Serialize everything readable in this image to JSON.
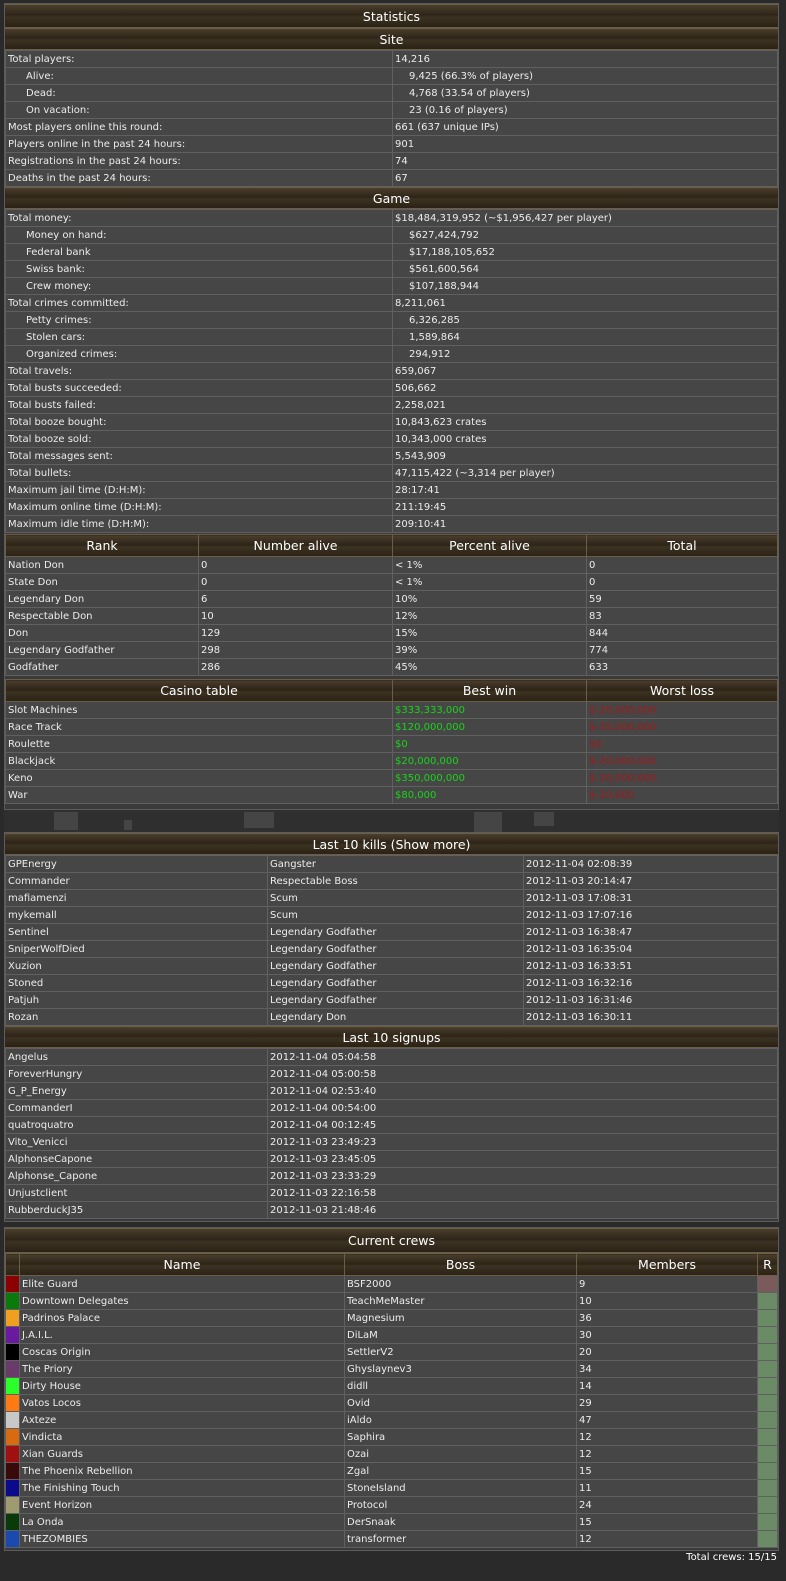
{
  "stats": {
    "title": "Statistics",
    "site_header": "Site",
    "site_rows": [
      {
        "label": "Total players:",
        "value": "14,216",
        "indent": false
      },
      {
        "label": "Alive:",
        "value": "9,425 (66.3% of players)",
        "indent": true
      },
      {
        "label": "Dead:",
        "value": "4,768 (33.54 of players)",
        "indent": true
      },
      {
        "label": "On vacation:",
        "value": "23 (0.16 of players)",
        "indent": true
      },
      {
        "label": "Most players online this round:",
        "value": "661 (637 unique IPs)",
        "indent": false
      },
      {
        "label": "Players online in the past 24 hours:",
        "value": "901",
        "indent": false
      },
      {
        "label": "Registrations in the past 24 hours:",
        "value": "74",
        "indent": false
      },
      {
        "label": "Deaths in the past 24 hours:",
        "value": "67",
        "indent": false
      }
    ],
    "game_header": "Game",
    "game_rows": [
      {
        "label": "Total money:",
        "value": "$18,484,319,952 (~$1,956,427 per player)",
        "indent": false
      },
      {
        "label": "Money on hand:",
        "value": "$627,424,792",
        "indent": true
      },
      {
        "label": "Federal bank",
        "value": "$17,188,105,652",
        "indent": true
      },
      {
        "label": "Swiss bank:",
        "value": "$561,600,564",
        "indent": true
      },
      {
        "label": "Crew money:",
        "value": "$107,188,944",
        "indent": true
      },
      {
        "label": "Total crimes committed:",
        "value": "8,211,061",
        "indent": false
      },
      {
        "label": "Petty crimes:",
        "value": "6,326,285",
        "indent": true
      },
      {
        "label": "Stolen cars:",
        "value": "1,589,864",
        "indent": true
      },
      {
        "label": "Organized crimes:",
        "value": "294,912",
        "indent": true
      },
      {
        "label": "Total travels:",
        "value": "659,067",
        "indent": false
      },
      {
        "label": "Total busts succeeded:",
        "value": "506,662",
        "indent": false
      },
      {
        "label": "Total busts failed:",
        "value": "2,258,021",
        "indent": false
      },
      {
        "label": "Total booze bought:",
        "value": "10,843,623 crates",
        "indent": false
      },
      {
        "label": "Total booze sold:",
        "value": "10,343,000 crates",
        "indent": false
      },
      {
        "label": "Total messages sent:",
        "value": "5,543,909",
        "indent": false
      },
      {
        "label": "Total bullets:",
        "value": "47,115,422 (~3,314 per player)",
        "indent": false
      },
      {
        "label": "Maximum jail time (D:H:M):",
        "value": "28:17:41",
        "indent": false
      },
      {
        "label": "Maximum online time (D:H:M):",
        "value": "211:19:45",
        "indent": false
      },
      {
        "label": "Maximum idle time (D:H:M):",
        "value": "209:10:41",
        "indent": false
      }
    ],
    "rank_headers": [
      "Rank",
      "Number alive",
      "Percent alive",
      "Total"
    ],
    "rank_rows": [
      [
        "Nation Don",
        "0",
        "< 1%",
        "0"
      ],
      [
        "State Don",
        "0",
        "< 1%",
        "0"
      ],
      [
        "Legendary Don",
        "6",
        "10%",
        "59"
      ],
      [
        "Respectable Don",
        "10",
        "12%",
        "83"
      ],
      [
        "Don",
        "129",
        "15%",
        "844"
      ],
      [
        "Legendary Godfather",
        "298",
        "39%",
        "774"
      ],
      [
        "Godfather",
        "286",
        "45%",
        "633"
      ]
    ],
    "casino_headers": [
      "Casino table",
      "Best win",
      "Worst loss"
    ],
    "casino_rows": [
      [
        "Slot Machines",
        "$333,333,000",
        "$-20,000,000"
      ],
      [
        "Race Track",
        "$120,000,000",
        "$-35,000,000"
      ],
      [
        "Roulette",
        "$0",
        "$0"
      ],
      [
        "Blackjack",
        "$20,000,000",
        "$-20,000,000"
      ],
      [
        "Keno",
        "$350,000,000",
        "$-20,000,000"
      ],
      [
        "War",
        "$80,000",
        "$-20,000"
      ]
    ]
  },
  "kills": {
    "title": "Last 10 kills (Show more)",
    "rows": [
      [
        "GPEnergy",
        "Gangster",
        "2012-11-04 02:08:39"
      ],
      [
        "Commander",
        "Respectable Boss",
        "2012-11-03 20:14:47"
      ],
      [
        "mafiamenzi",
        "Scum",
        "2012-11-03 17:08:31"
      ],
      [
        "mykemall",
        "Scum",
        "2012-11-03 17:07:16"
      ],
      [
        "Sentinel",
        "Legendary Godfather",
        "2012-11-03 16:38:47"
      ],
      [
        "SniperWolfDied",
        "Legendary Godfather",
        "2012-11-03 16:35:04"
      ],
      [
        "Xuzion",
        "Legendary Godfather",
        "2012-11-03 16:33:51"
      ],
      [
        "Stoned",
        "Legendary Godfather",
        "2012-11-03 16:32:16"
      ],
      [
        "Patjuh",
        "Legendary Godfather",
        "2012-11-03 16:31:46"
      ],
      [
        "Rozan",
        "Legendary Don",
        "2012-11-03 16:30:11"
      ]
    ],
    "signups_title": "Last 10 signups",
    "signups": [
      [
        "Angelus",
        "2012-11-04 05:04:58"
      ],
      [
        "ForeverHungry",
        "2012-11-04 05:00:58"
      ],
      [
        "G_P_Energy",
        "2012-11-04 02:53:40"
      ],
      [
        "CommanderI",
        "2012-11-04 00:54:00"
      ],
      [
        "quatroquatro",
        "2012-11-04 00:12:45"
      ],
      [
        "Vito_Venicci",
        "2012-11-03 23:49:23"
      ],
      [
        "AlphonseCapone",
        "2012-11-03 23:45:05"
      ],
      [
        "Alphonse_Capone",
        "2012-11-03 23:33:29"
      ],
      [
        "Unjustclient",
        "2012-11-03 22:16:58"
      ],
      [
        "RubberduckJ35",
        "2012-11-03 21:48:46"
      ]
    ]
  },
  "crews": {
    "title": "Current crews",
    "headers": [
      "Name",
      "Boss",
      "Members",
      "R"
    ],
    "rows": [
      {
        "color": "#8b0000",
        "name": "Elite Guard",
        "boss": "BSF2000",
        "members": "9"
      },
      {
        "color": "#0a7a0a",
        "name": "Downtown Delegates",
        "boss": "TeachMeMaster",
        "members": "10"
      },
      {
        "color": "#f0a020",
        "name": "Padrinos Palace",
        "boss": "Magnesium",
        "members": "36"
      },
      {
        "color": "#6a1aa0",
        "name": "J.A.I.L.",
        "boss": "DiLaM",
        "members": "30"
      },
      {
        "color": "#000000",
        "name": "Coscas Origin",
        "boss": "SettlerV2",
        "members": "20"
      },
      {
        "color": "#6a3a6a",
        "name": "The Priory",
        "boss": "Ghyslaynev3",
        "members": "34"
      },
      {
        "color": "#2aff2a",
        "name": "Dirty House",
        "boss": "didll",
        "members": "14"
      },
      {
        "color": "#ff7a10",
        "name": "Vatos Locos",
        "boss": "Ovid",
        "members": "29"
      },
      {
        "color": "#c8c8c8",
        "name": "Axteze",
        "boss": "iAldo",
        "members": "47"
      },
      {
        "color": "#d86a10",
        "name": "Vindicta",
        "boss": "Saphira",
        "members": "12"
      },
      {
        "color": "#a01010",
        "name": "Xian Guards",
        "boss": "Ozai",
        "members": "12"
      },
      {
        "color": "#3a0a0a",
        "name": "The Phoenix Rebellion",
        "boss": "Zgal",
        "members": "15"
      },
      {
        "color": "#0a0a8a",
        "name": "The Finishing Touch",
        "boss": "StoneIsland",
        "members": "11"
      },
      {
        "color": "#a09a70",
        "name": "Event Horizon",
        "boss": "Protocol",
        "members": "24"
      },
      {
        "color": "#0a3a0a",
        "name": "La Onda",
        "boss": "DerSnaak",
        "members": "15"
      },
      {
        "color": "#1a4ab0",
        "name": "THEZOMBIES",
        "boss": "transformer",
        "members": "12"
      }
    ],
    "footer": "Total crews: 15/15"
  }
}
